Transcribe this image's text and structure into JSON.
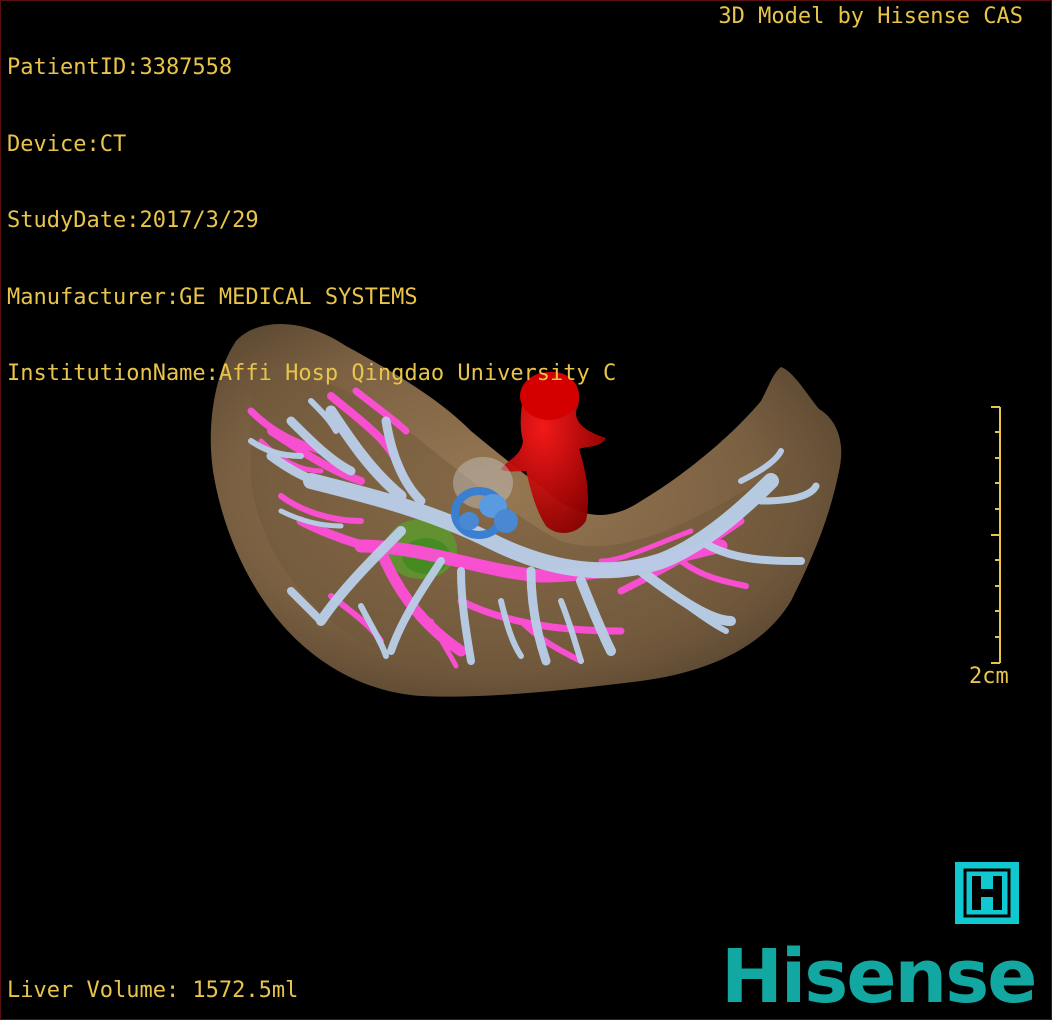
{
  "overlay": {
    "patient_id": "PatientID:3387558",
    "device": "Device:CT",
    "study_date": "StudyDate:2017/3/29",
    "manufacturer": "Manufacturer:GE MEDICAL SYSTEMS",
    "institution": "InstitutionName:Affi Hosp Qingdao University C",
    "model_credit": "3D Model by Hisense CAS",
    "liver_volume": "Liver Volume: 1572.5ml"
  },
  "scale_bar": {
    "label": "2cm",
    "color": "#e8c54a"
  },
  "branding": {
    "badge_icon": "h-logo-icon",
    "badge_color": "#10c8d0",
    "logo_text": "Hisense",
    "logo_color": "#13a7a1"
  },
  "model": {
    "liver_color": "#8a6e4b",
    "portal_vein_color": "#b8cde6",
    "hepatic_artery_color": "#ff4fd8",
    "vena_cava_color": "#c00000",
    "lesion_color": "#5aa02c",
    "marker_color": "#3a7fd0"
  }
}
